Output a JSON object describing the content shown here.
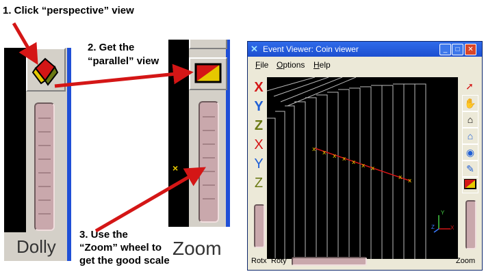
{
  "steps": {
    "step1": "1. Click “perspective” view",
    "step2_line1": "2. Get the",
    "step2_line2": "“parallel” view",
    "step3_line1": "3. Use the",
    "step3_line2": "“Zoom” wheel to",
    "step3_line3": "get the good scale"
  },
  "crops": {
    "dolly_label": "Dolly",
    "zoom_label": "Zoom"
  },
  "window": {
    "title": "Event Viewer: Coin viewer",
    "menu": [
      "File",
      "Options",
      "Help"
    ],
    "left_tools": [
      "X",
      "Y",
      "Z",
      "X",
      "Y",
      "Z"
    ],
    "right_tools": [
      "pointer-icon",
      "hand-icon",
      "home-icon",
      "set-home-icon",
      "view-all-icon",
      "seek-icon",
      "projection-icon"
    ],
    "rotx_label": "Rotx",
    "roty_label": "Roty",
    "zoom_label": "Zoom",
    "axis_y": "Y",
    "axis_z": "Z",
    "axis_x": "X"
  },
  "colors": {
    "arrow": "#d41616",
    "title_blue": "#1c4fd0",
    "track": "#d41616",
    "hit": "#e6c800"
  }
}
